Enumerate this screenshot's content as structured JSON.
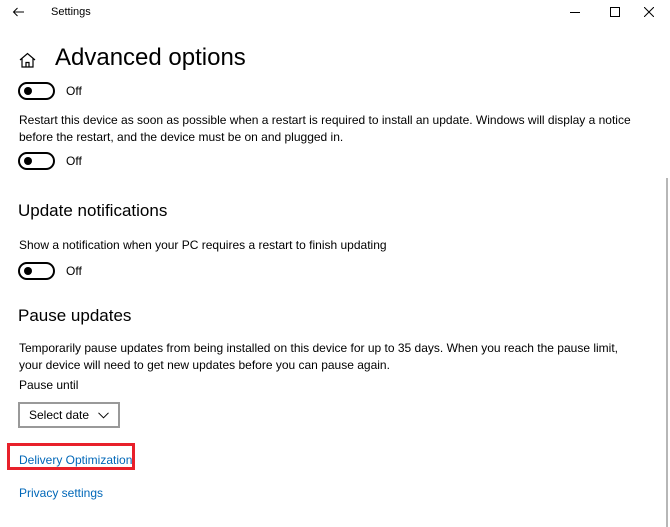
{
  "window": {
    "title": "Settings"
  },
  "page": {
    "title": "Advanced options"
  },
  "toggles": {
    "first": {
      "label": "Off",
      "on": false
    },
    "restart": {
      "label": "Off",
      "on": false
    },
    "notify": {
      "label": "Off",
      "on": false
    }
  },
  "restart_text": "Restart this device as soon as possible when a restart is required to install an update. Windows will display a notice before the restart, and the device must be on and plugged in.",
  "update_notifications": {
    "heading": "Update notifications",
    "description": "Show a notification when your PC requires a restart to finish updating"
  },
  "pause_updates": {
    "heading": "Pause updates",
    "description": "Temporarily pause updates from being installed on this device for up to 35 days. When you reach the pause limit, your device will need to get new updates before you can pause again.",
    "pause_until_label": "Pause until",
    "select_value": "Select date"
  },
  "links": {
    "delivery_optimization": "Delivery Optimization",
    "privacy_settings": "Privacy settings"
  },
  "colors": {
    "link": "#0067b8",
    "highlight": "#e8202a"
  },
  "icons": {
    "back": "back-arrow-icon",
    "home": "home-icon",
    "minimize": "minimize-icon",
    "maximize": "maximize-icon",
    "close": "close-icon",
    "dropdown": "chevron-down-icon"
  }
}
